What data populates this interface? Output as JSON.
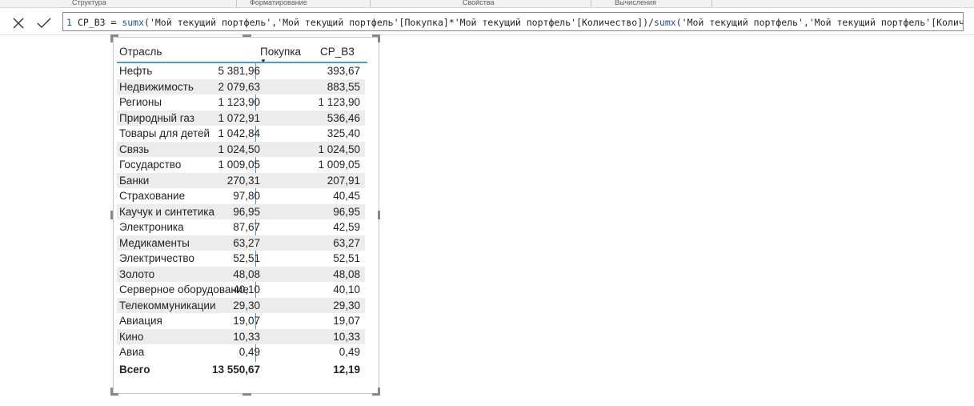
{
  "ribbon": {
    "groups": [
      "Структура",
      "Форматирование",
      "Свойства",
      "Вычисления"
    ]
  },
  "formula_bar": {
    "line_number": "1",
    "formula_parts": {
      "p1": "CP_B3 = ",
      "fn1": "sumx",
      "p2": "('Мой текущий портфель','Мой текущий портфель'[Покупка]*'Мой текущий портфель'[Количество])/",
      "fn2": "sumx",
      "p3": "('Мой текущий портфель','Мой текущий портфель'[Количество]",
      "p4": ")"
    }
  },
  "table": {
    "headers": {
      "col1": "Отрасль",
      "col2": "Покупка",
      "col3": "CP_B3"
    },
    "sort_indicator": "▼",
    "rows": [
      {
        "name": "Нефть",
        "buy": "5 381,96",
        "cp": "393,67"
      },
      {
        "name": "Недвижимость",
        "buy": "2 079,63",
        "cp": "883,55"
      },
      {
        "name": "Регионы",
        "buy": "1 123,90",
        "cp": "1 123,90"
      },
      {
        "name": "Природный газ",
        "buy": "1 072,91",
        "cp": "536,46"
      },
      {
        "name": "Товары для детей",
        "buy": "1 042,84",
        "cp": "325,40"
      },
      {
        "name": "Связь",
        "buy": "1 024,50",
        "cp": "1 024,50"
      },
      {
        "name": "Государство",
        "buy": "1 009,05",
        "cp": "1 009,05"
      },
      {
        "name": "Банки",
        "buy": "270,31",
        "cp": "207,91"
      },
      {
        "name": "Страхование",
        "buy": "97,80",
        "cp": "40,45"
      },
      {
        "name": "Каучук и синтетика",
        "buy": "96,95",
        "cp": "96,95"
      },
      {
        "name": "Электроника",
        "buy": "87,67",
        "cp": "42,59"
      },
      {
        "name": "Медикаменты",
        "buy": "63,27",
        "cp": "63,27"
      },
      {
        "name": "Электричество",
        "buy": "52,51",
        "cp": "52,51"
      },
      {
        "name": "Золото",
        "buy": "48,08",
        "cp": "48,08"
      },
      {
        "name": "Серверное оборудование",
        "buy": "40,10",
        "cp": "40,10"
      },
      {
        "name": "Телекоммуникации",
        "buy": "29,30",
        "cp": "29,30"
      },
      {
        "name": "Авиация",
        "buy": "19,07",
        "cp": "19,07"
      },
      {
        "name": "Кино",
        "buy": "10,33",
        "cp": "10,33"
      },
      {
        "name": "Авиа",
        "buy": "0,49",
        "cp": "0,49"
      }
    ],
    "total": {
      "name": "Всего",
      "buy": "13 550,67",
      "cp": "12,19"
    }
  },
  "colors": {
    "accent": "#4d9ad8",
    "row_shade": "#ececec",
    "formula_fn": "#1f4e9e"
  }
}
